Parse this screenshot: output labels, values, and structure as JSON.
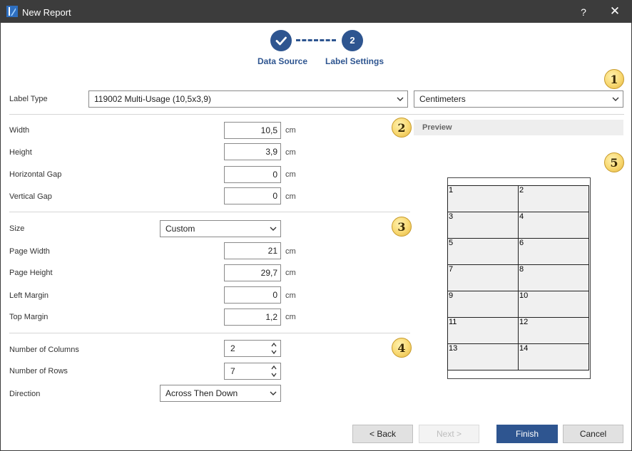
{
  "window": {
    "title": "New Report",
    "help_label": "?",
    "close_label": "✕"
  },
  "steps": [
    {
      "number": "✓",
      "label": "Data Source"
    },
    {
      "number": "2",
      "label": "Label Settings"
    }
  ],
  "label_type": {
    "label": "Label Type",
    "value": "119002 Multi-Usage (10,5x3,9)"
  },
  "units": {
    "value": "Centimeters"
  },
  "label_dims": {
    "width": {
      "label": "Width",
      "value": "10,5",
      "unit": "cm"
    },
    "height": {
      "label": "Height",
      "value": "3,9",
      "unit": "cm"
    },
    "horizontal_gap": {
      "label": "Horizontal Gap",
      "value": "0",
      "unit": "cm"
    },
    "vertical_gap": {
      "label": "Vertical Gap",
      "value": "0",
      "unit": "cm"
    }
  },
  "page": {
    "size": {
      "label": "Size",
      "value": "Custom"
    },
    "page_width": {
      "label": "Page Width",
      "value": "21",
      "unit": "cm"
    },
    "page_height": {
      "label": "Page Height",
      "value": "29,7",
      "unit": "cm"
    },
    "left_margin": {
      "label": "Left Margin",
      "value": "0",
      "unit": "cm"
    },
    "top_margin": {
      "label": "Top Margin",
      "value": "1,2",
      "unit": "cm"
    }
  },
  "layout": {
    "columns": {
      "label": "Number of Columns",
      "value": "2"
    },
    "rows": {
      "label": "Number of Rows",
      "value": "7"
    },
    "direction": {
      "label": "Direction",
      "value": "Across Then Down"
    }
  },
  "badges": [
    "1",
    "2",
    "3",
    "4",
    "5"
  ],
  "preview": {
    "title": "Preview",
    "cells": [
      "1",
      "2",
      "3",
      "4",
      "5",
      "6",
      "7",
      "8",
      "9",
      "10",
      "11",
      "12",
      "13",
      "14"
    ]
  },
  "buttons": {
    "back": "< Back",
    "next": "Next >",
    "finish": "Finish",
    "cancel": "Cancel"
  },
  "colors": {
    "accent": "#2e5590",
    "titlebar": "#3c3c3c",
    "badge": "#f8d871"
  }
}
